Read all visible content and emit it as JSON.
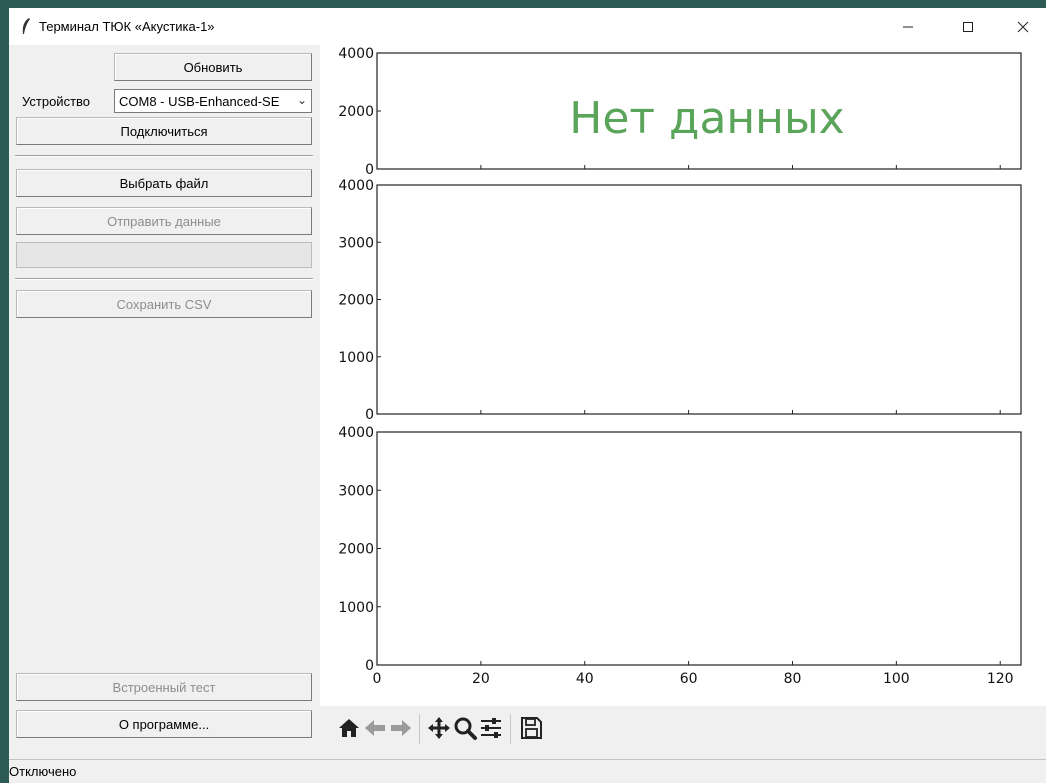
{
  "window": {
    "title": "Терминал ТЮК «Акустика-1»",
    "controls": [
      "minimize-icon",
      "maximize-icon",
      "close-icon"
    ]
  },
  "sidebar": {
    "refresh_label": "Обновить",
    "device_label": "Устройство",
    "device_value": "COM8 - USB-Enhanced-SE",
    "connect_label": "Подключиться",
    "choose_file_label": "Выбрать файл",
    "send_data_label": "Отправить данные",
    "save_csv_label": "Сохранить CSV",
    "self_test_label": "Встроенный тест",
    "about_label": "О программе..."
  },
  "plots": {
    "no_data_text": "Нет данных",
    "no_data_color": "#5aa55a"
  },
  "chart_data": [
    {
      "type": "line",
      "series": [],
      "yticks": [
        0,
        2000,
        4000
      ],
      "ylim": [
        0,
        4000
      ],
      "xlim": [
        0,
        124
      ]
    },
    {
      "type": "line",
      "series": [],
      "yticks": [
        0,
        1000,
        2000,
        3000,
        4000
      ],
      "ylim": [
        0,
        4000
      ],
      "xlim": [
        0,
        124
      ]
    },
    {
      "type": "line",
      "series": [],
      "yticks": [
        0,
        1000,
        2000,
        3000,
        4000
      ],
      "xticks": [
        0,
        20,
        40,
        60,
        80,
        100,
        120
      ],
      "ylim": [
        0,
        4000
      ],
      "xlim": [
        0,
        124
      ]
    }
  ],
  "toolbar": {
    "icons": [
      "home-icon",
      "back-icon",
      "forward-icon",
      "pan-icon",
      "zoom-icon",
      "configure-subplots-icon",
      "save-icon"
    ]
  },
  "status": {
    "text": "Отключено"
  }
}
